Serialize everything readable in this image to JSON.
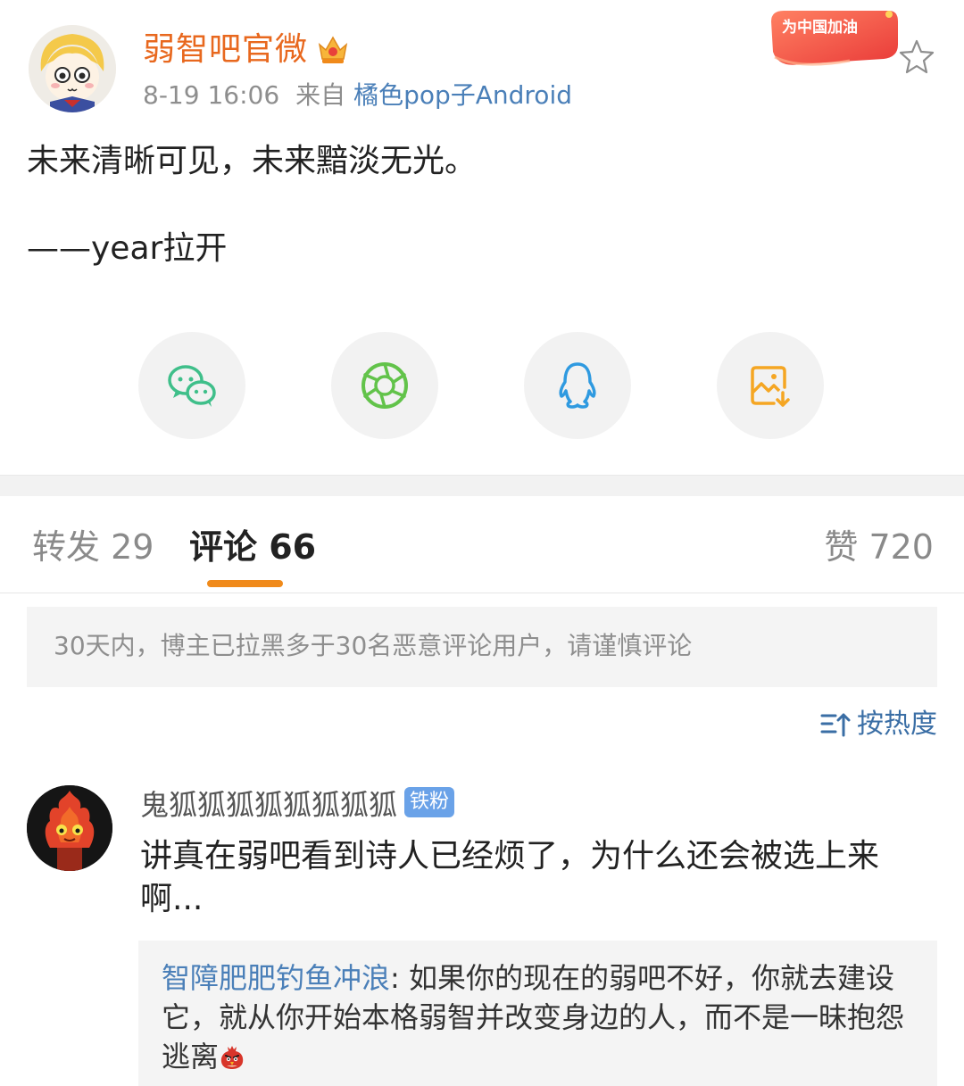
{
  "post": {
    "author": "弱智吧官微",
    "time": "8-19 16:06",
    "source_prefix": "来自",
    "source": "橘色pop子Android",
    "promo_badge": "为中国加油",
    "lines": [
      "未来清晰可见，未来黯淡无光。",
      "——year拉开"
    ]
  },
  "share": {
    "items": [
      {
        "name": "wechat-icon"
      },
      {
        "name": "moments-icon"
      },
      {
        "name": "qq-icon"
      },
      {
        "name": "save-image-icon"
      }
    ]
  },
  "tabs": {
    "repost": "转发 29",
    "comment": "评论 66",
    "like": "赞 720"
  },
  "notice": "30天内，博主已拉黑多于30名恶意评论用户，请谨慎评论",
  "sort": {
    "label": "按热度"
  },
  "comment": {
    "user": "鬼狐狐狐狐狐狐狐狐",
    "badge": "铁粉",
    "text": "讲真在弱吧看到诗人已经烦了，为什么还会被选上来啊...",
    "reply": {
      "user": "智障肥肥钓鱼冲浪",
      "separator": ": ",
      "text": "如果你的现在的弱吧不好，你就去建设它，就从你开始本格弱智并改变身边的人，而不是一昧抱怨逃离"
    }
  },
  "colors": {
    "author_name": "#e8681e",
    "link_blue": "#4a7fb8",
    "tab_indicator": "#f08a1a",
    "fan_badge": "#6aa2e8"
  }
}
